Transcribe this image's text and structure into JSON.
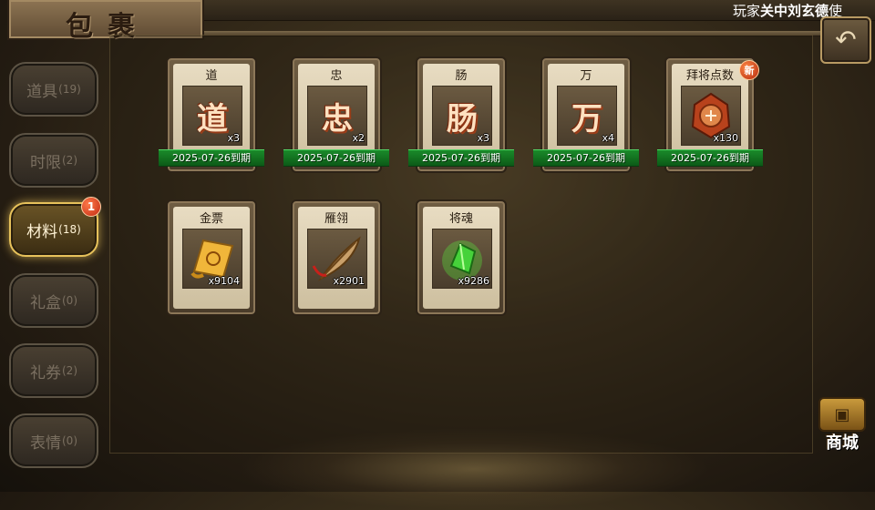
{
  "header": {
    "title": "包裹"
  },
  "marquee": {
    "prefix": "玩家",
    "player": "关中刘玄德",
    "suffix": "使"
  },
  "icons": {
    "back": "back-arrow-icon",
    "shop": "treasure-chest-icon"
  },
  "sidebar": {
    "tabs": [
      {
        "label": "道具",
        "count": "(19)",
        "active": false
      },
      {
        "label": "时限",
        "count": "(2)",
        "active": false
      },
      {
        "label": "材料",
        "count": "(18)",
        "active": true,
        "badge": "1"
      },
      {
        "label": "礼盒",
        "count": "(0)",
        "active": false
      },
      {
        "label": "礼券",
        "count": "(2)",
        "active": false
      },
      {
        "label": "表情",
        "count": "(0)",
        "active": false
      }
    ]
  },
  "items": [
    {
      "name": "道",
      "glyph": "道",
      "qty": "x3",
      "expiry": "2025-07-26到期"
    },
    {
      "name": "忠",
      "glyph": "忠",
      "qty": "x2",
      "expiry": "2025-07-26到期"
    },
    {
      "name": "肠",
      "glyph": "肠",
      "qty": "x3",
      "expiry": "2025-07-26到期"
    },
    {
      "name": "万",
      "glyph": "万",
      "qty": "x4",
      "expiry": "2025-07-26到期"
    },
    {
      "name": "拜将点数",
      "icon": "seal-token-icon",
      "qty": "x130",
      "expiry": "2025-07-26到期",
      "badge": "新"
    },
    {
      "name": "金票",
      "icon": "gold-ticket-scroll-icon",
      "qty": "x9104"
    },
    {
      "name": "雁翎",
      "icon": "feather-icon",
      "qty": "x2901"
    },
    {
      "name": "将魂",
      "icon": "green-crystal-icon",
      "qty": "x9286"
    }
  ],
  "shop": {
    "label": "商城"
  },
  "colors": {
    "accent_gold": "#e7c25b",
    "expiry_green": "#1a8a2a",
    "badge_red": "#c22a12"
  }
}
